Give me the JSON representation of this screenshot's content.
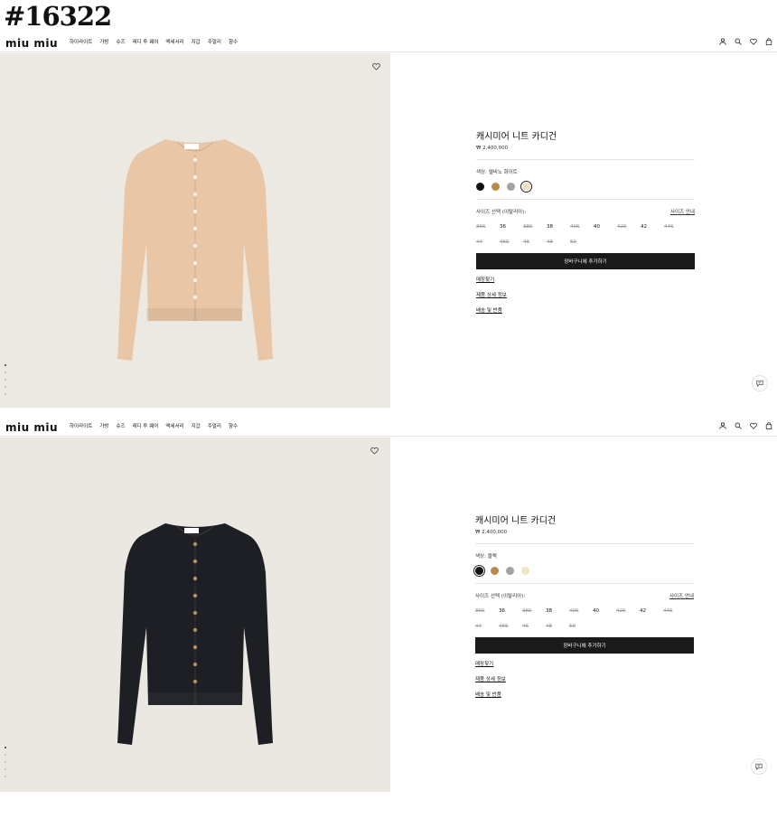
{
  "tag": "#16322",
  "header": {
    "logo": "miu miu",
    "nav": [
      "하이라이트",
      "가방",
      "슈즈",
      "레디 투 웨어",
      "액세서리",
      "지갑",
      "주얼리",
      "향수"
    ],
    "icons": [
      "user-icon",
      "search-icon",
      "heart-icon",
      "bag-icon"
    ]
  },
  "common": {
    "title": "캐시미어 니트 카디건",
    "price": "₩ 2,400,000",
    "size_label": "사이즈 선택 (이탈리아):",
    "size_guide": "사이즈 안내",
    "sizes": [
      {
        "label": "36S",
        "available": false
      },
      {
        "label": "36",
        "available": true
      },
      {
        "label": "38S",
        "available": false
      },
      {
        "label": "38",
        "available": true
      },
      {
        "label": "40S",
        "available": false
      },
      {
        "label": "40",
        "available": true
      },
      {
        "label": "42S",
        "available": false
      },
      {
        "label": "42",
        "available": true
      },
      {
        "label": "44S",
        "available": false
      },
      {
        "label": "44",
        "available": false
      },
      {
        "label": "46S",
        "available": false
      },
      {
        "label": "46",
        "available": false
      },
      {
        "label": "48",
        "available": false
      },
      {
        "label": "50",
        "available": false
      }
    ],
    "cart_label": "장바구니에 추가하기",
    "links": [
      "매장찾기",
      "제품 상세 정보",
      "배송 및 반품"
    ],
    "swatches": [
      "#111111",
      "#b88a4e",
      "#a3a3a3",
      "#f1e4c3"
    ]
  },
  "views": [
    {
      "color_label": "색상: 엘비노 화이트",
      "selected_swatch": 3,
      "product_color": "#e9c6a6",
      "bg": "#ece8e2"
    },
    {
      "color_label": "색상: 블랙",
      "selected_swatch": 0,
      "product_color": "#1d1f24",
      "bg": "#ebe7e1"
    }
  ]
}
